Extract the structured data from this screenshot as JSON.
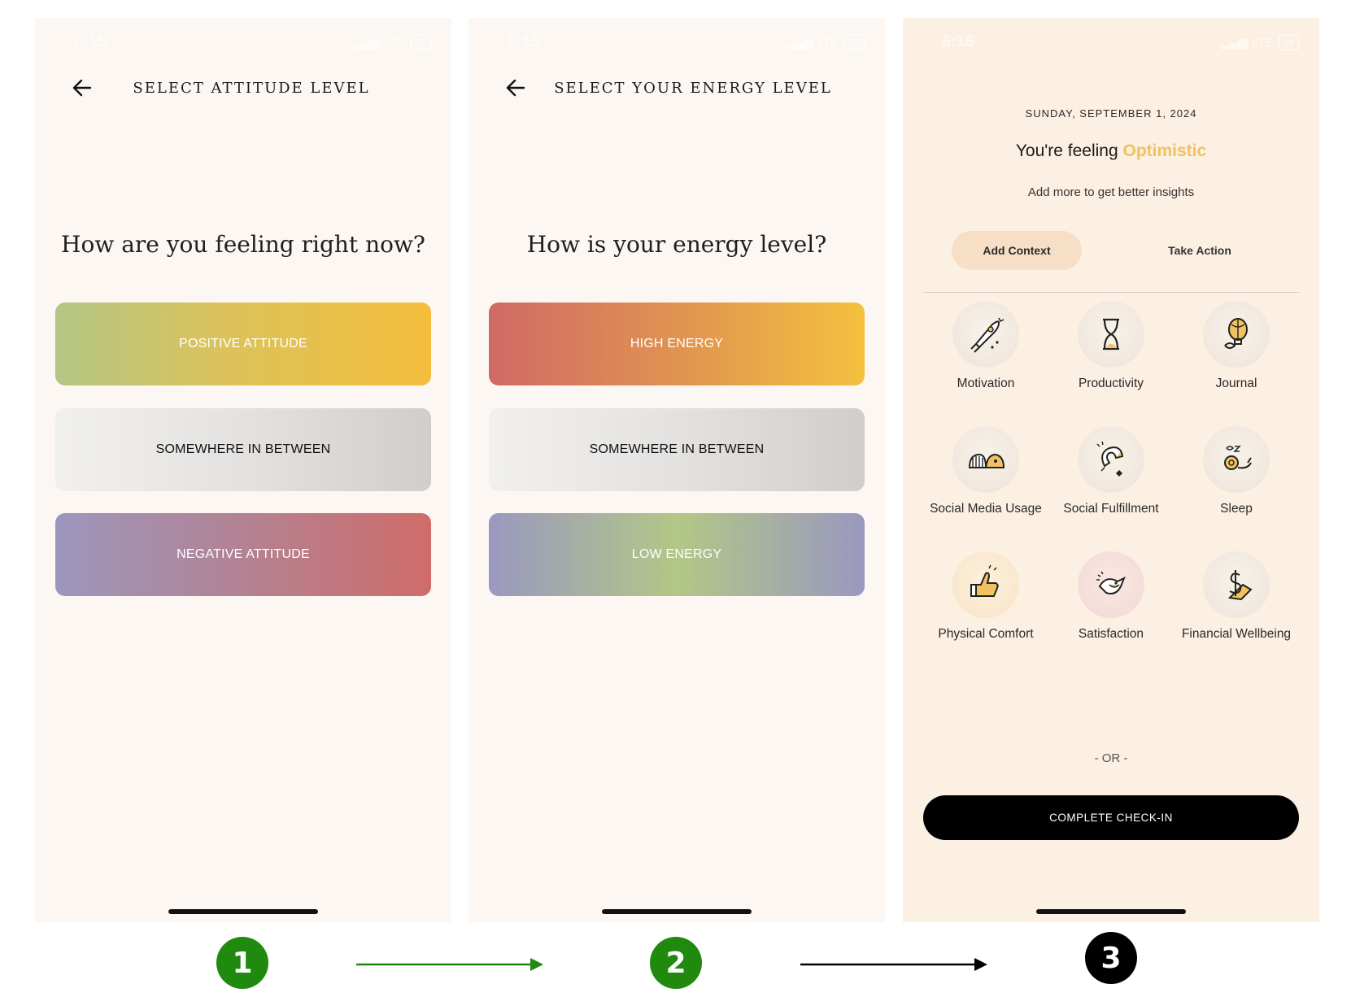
{
  "screen1": {
    "status_time": "6:15",
    "status_network": "LTE",
    "status_battery": "26",
    "header_title": "SELECT ATTITUDE LEVEL",
    "question": "How are you feeling right now?",
    "options": [
      "POSITIVE ATTITUDE",
      "SOMEWHERE IN BETWEEN",
      "NEGATIVE ATTITUDE"
    ]
  },
  "screen2": {
    "status_time": "6:15",
    "status_network": "LTE",
    "status_battery": "26",
    "header_title": "SELECT YOUR ENERGY LEVEL",
    "question": "How is your energy level?",
    "options": [
      "HIGH ENERGY",
      "SOMEWHERE IN BETWEEN",
      "LOW ENERGY"
    ]
  },
  "screen3": {
    "status_time": "6:16",
    "status_network": "LTE",
    "status_battery": "26",
    "date": "SUNDAY, SEPTEMBER 1, 2024",
    "feeling_prefix": "You're feeling",
    "mood": "Optimistic",
    "subtitle": "Add more to get better insights",
    "tabs": [
      "Add Context",
      "Take Action"
    ],
    "categories": [
      {
        "label": "Motivation",
        "icon": "rocket-icon"
      },
      {
        "label": "Productivity",
        "icon": "hourglass-icon"
      },
      {
        "label": "Journal",
        "icon": "balloon-icon"
      },
      {
        "label": "Social Media Usage",
        "icon": "devices-icon"
      },
      {
        "label": "Social Fulfillment",
        "icon": "magnet-icon"
      },
      {
        "label": "Sleep",
        "icon": "snail-icon"
      },
      {
        "label": "Physical Comfort",
        "icon": "thumbs-up-icon"
      },
      {
        "label": "Satisfaction",
        "icon": "bird-icon"
      },
      {
        "label": "Financial Wellbeing",
        "icon": "dollar-icon"
      }
    ],
    "or_text": "- OR -",
    "cta": "COMPLETE CHECK-IN"
  },
  "steps": [
    "1",
    "2",
    "3"
  ],
  "colors": {
    "screen_bg": "#fcf7f2",
    "screen3_bg": "#fcf0e2",
    "mood_accent": "#f1c25f",
    "step_green": "#1f8a0d",
    "step_black": "#000000",
    "active_tab": "#f6dfc6"
  }
}
